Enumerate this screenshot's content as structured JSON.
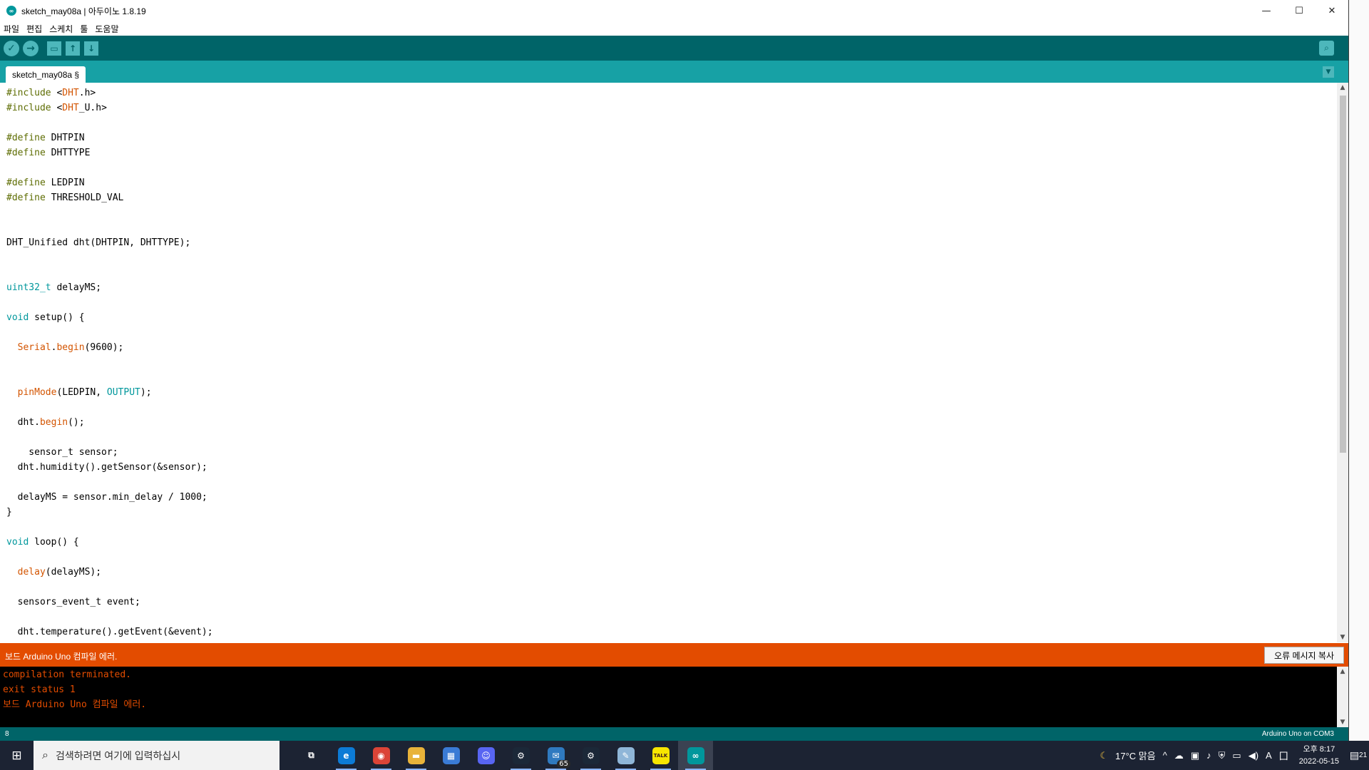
{
  "window": {
    "title": "sketch_may08a | 아두이노 1.8.19",
    "logo_text": "∞",
    "minimize": "—",
    "maximize": "☐",
    "close": "✕"
  },
  "menu": [
    "파일",
    "편집",
    "스케치",
    "툴",
    "도움말"
  ],
  "toolbar": {
    "verify": "✓",
    "upload": "→",
    "new": "▭",
    "open": "↑",
    "save": "↓",
    "serial": "⌕"
  },
  "tabs": {
    "active": "sketch_may08a §",
    "menu_arrow": "▼"
  },
  "code_lines": [
    "#include <DHT.h>",
    "#include <DHT_U.h>",
    "",
    "#define DHTPIN",
    "#define DHTTYPE",
    "",
    "#define LEDPIN",
    "#define THRESHOLD_VAL",
    "",
    "",
    "DHT_Unified dht(DHTPIN, DHTTYPE);",
    "",
    "",
    "uint32_t delayMS;",
    "",
    "void setup() {",
    "",
    "  Serial.begin(9600);",
    "",
    "",
    "  pinMode(LEDPIN, OUTPUT);",
    "",
    "  dht.begin();",
    "",
    "    sensor_t sensor;",
    "  dht.humidity().getSensor(&sensor);",
    "",
    "  delayMS = sensor.min_delay / 1000;",
    "}",
    "",
    "void loop() {",
    "",
    "  delay(delayMS);",
    "",
    "  sensors_event_t event;",
    "",
    "  dht.temperature().getEvent(&event);"
  ],
  "status": {
    "error_message": "보드 Arduino Uno 컴파일 에러.",
    "copy_button": "오류 메시지 복사"
  },
  "console_lines": [
    "compilation terminated.",
    "exit status 1",
    "보드 Arduino Uno 컴파일 에러."
  ],
  "statusline": {
    "line_number": "8",
    "board": "Arduino Uno on COM3"
  },
  "taskbar": {
    "search_placeholder": "검색하려면 여기에 입력하십시",
    "mail_badge": "65",
    "apps": [
      {
        "name": "task-view",
        "glyph": "⧉",
        "color": "#1c2333"
      },
      {
        "name": "edge",
        "glyph": "e",
        "color": "#0c7bd6"
      },
      {
        "name": "chrome",
        "glyph": "◉",
        "color": "#db4437"
      },
      {
        "name": "file-explorer",
        "glyph": "▬",
        "color": "#e8b33a"
      },
      {
        "name": "store",
        "glyph": "▦",
        "color": "#3a7bd5"
      },
      {
        "name": "discord",
        "glyph": "☺",
        "color": "#5865f2"
      },
      {
        "name": "steam",
        "glyph": "⚙",
        "color": "#1b2838"
      },
      {
        "name": "mail",
        "glyph": "✉",
        "color": "#2f7ac0"
      },
      {
        "name": "steam-2",
        "glyph": "⚙",
        "color": "#1b2838"
      },
      {
        "name": "notes",
        "glyph": "✎",
        "color": "#8fb6d8"
      },
      {
        "name": "kakaotalk",
        "glyph": "TALK",
        "color": "#f7e600"
      },
      {
        "name": "arduino",
        "glyph": "∞",
        "color": "#00979c"
      }
    ],
    "weather": "17°C 맑음",
    "ime": "A",
    "ime2": "囗",
    "time": "오후 8:17",
    "date": "2022-05-15",
    "notif_count": "21"
  },
  "colors": {
    "teal_dark": "#006468",
    "teal": "#17a1a5",
    "error_orange": "#e34c00",
    "keyword": "#00979c",
    "function": "#d35400",
    "preprocessor": "#5e6d03"
  }
}
